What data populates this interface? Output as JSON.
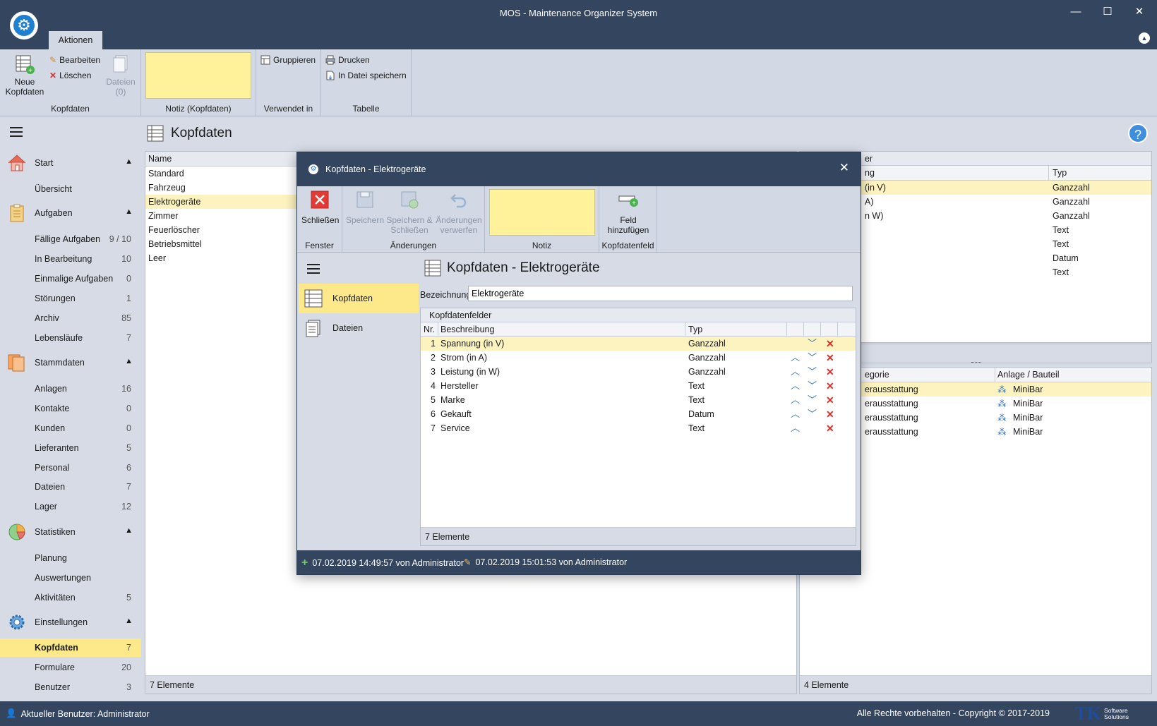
{
  "window": {
    "title": "MOS - Maintenance Organizer System",
    "minimize": "—",
    "maximize": "☐",
    "close": "✕"
  },
  "ribbon": {
    "tab_label": "Aktionen",
    "groups": {
      "kopfdaten": {
        "label": "Kopfdaten",
        "new_line1": "Neue",
        "new_line2": "Kopfdaten",
        "edit": "Bearbeiten",
        "delete": "Löschen",
        "files_line1": "Dateien",
        "files_line2": "(0)"
      },
      "notiz": {
        "label": "Notiz (Kopfdaten)"
      },
      "verwendet": {
        "label": "Verwendet in",
        "group": "Gruppieren"
      },
      "tabelle": {
        "label": "Tabelle",
        "print": "Drucken",
        "save_file": "In Datei speichern"
      }
    }
  },
  "sidebar": {
    "sections": [
      {
        "label": "Start",
        "icon": "house-icon"
      },
      {
        "label": "Aufgaben",
        "icon": "clipboard-icon"
      },
      {
        "label": "Stammdaten",
        "icon": "documents-icon"
      },
      {
        "label": "Statistiken",
        "icon": "pie-chart-icon"
      },
      {
        "label": "Einstellungen",
        "icon": "gear-icon"
      }
    ],
    "items": [
      {
        "label": "Übersicht",
        "count": ""
      },
      {
        "label": "Fällige Aufgaben",
        "count": "9 / 10"
      },
      {
        "label": "In Bearbeitung",
        "count": "10"
      },
      {
        "label": "Einmalige Aufgaben",
        "count": "0"
      },
      {
        "label": "Störungen",
        "count": "1"
      },
      {
        "label": "Archiv",
        "count": "85"
      },
      {
        "label": "Lebensläufe",
        "count": "7"
      },
      {
        "label": "Anlagen",
        "count": "16"
      },
      {
        "label": "Kontakte",
        "count": "0"
      },
      {
        "label": "Kunden",
        "count": "0"
      },
      {
        "label": "Lieferanten",
        "count": "5"
      },
      {
        "label": "Personal",
        "count": "6"
      },
      {
        "label": "Dateien",
        "count": "7"
      },
      {
        "label": "Lager",
        "count": "12"
      },
      {
        "label": "Planung",
        "count": ""
      },
      {
        "label": "Auswertungen",
        "count": ""
      },
      {
        "label": "Aktivitäten",
        "count": "5"
      },
      {
        "label": "Kopfdaten",
        "count": "7"
      },
      {
        "label": "Formulare",
        "count": "20"
      },
      {
        "label": "Benutzer",
        "count": "3"
      }
    ]
  },
  "page": {
    "title": "Kopfdaten",
    "help": "?"
  },
  "list": {
    "header": "Name",
    "rows": [
      "Standard",
      "Fahrzeug",
      "Elektrogeräte",
      "Zimmer",
      "Feuerlöscher",
      "Betriebsmittel",
      "Leer"
    ],
    "footer": "7 Elemente"
  },
  "right_top": {
    "group_header": "er",
    "col1": "ng",
    "col2": "Typ",
    "rows": [
      {
        "c1": "(in V)",
        "c2": "Ganzzahl"
      },
      {
        "c1": "A)",
        "c2": "Ganzzahl"
      },
      {
        "c1": "n W)",
        "c2": "Ganzzahl"
      },
      {
        "c1": "",
        "c2": "Text"
      },
      {
        "c1": "",
        "c2": "Text"
      },
      {
        "c1": "",
        "c2": "Datum"
      },
      {
        "c1": "",
        "c2": "Text"
      }
    ]
  },
  "right_bottom": {
    "col1": "egorie",
    "col2": "Anlage / Bauteil",
    "rows": [
      {
        "c1": "erausstattung",
        "c2": "MiniBar"
      },
      {
        "c1": "erausstattung",
        "c2": "MiniBar"
      },
      {
        "c1": "erausstattung",
        "c2": "MiniBar"
      },
      {
        "c1": "erausstattung",
        "c2": "MiniBar"
      }
    ],
    "footer": "4 Elemente"
  },
  "status": {
    "user": "Aktueller Benutzer: Administrator",
    "copyright": "Alle Rechte vorbehalten - Copyright © 2017-2019",
    "logo_tk": "TK",
    "logo_sub1": "Software",
    "logo_sub2": "Solutions"
  },
  "dialog": {
    "title": "Kopfdaten - Elektrogeräte",
    "ribbon": {
      "close": "Schließen",
      "group_fenster": "Fenster",
      "save": "Speichern",
      "save_close_line1": "Speichern &",
      "save_close_line2": "Schließen",
      "discard_line1": "Änderungen",
      "discard_line2": "verwerfen",
      "group_aenderungen": "Änderungen",
      "group_notiz": "Notiz",
      "add_field_line1": "Feld",
      "add_field_line2": "hinzufügen",
      "group_kopfdatenfeld": "Kopfdatenfeld"
    },
    "nav": [
      {
        "label": "Kopfdaten",
        "icon": "table-icon"
      },
      {
        "label": "Dateien",
        "icon": "document-icon"
      }
    ],
    "page_title": "Kopfdaten - Elektrogeräte",
    "bezeichnung_label": "Bezeichnung",
    "bezeichnung_value": "Elektrogeräte",
    "fields_title": "Kopfdatenfelder",
    "columns": {
      "nr": "Nr.",
      "desc": "Beschreibung",
      "type": "Typ"
    },
    "fields": [
      {
        "nr": "1",
        "desc": "Spannung (in V)",
        "type": "Ganzzahl"
      },
      {
        "nr": "2",
        "desc": "Strom (in A)",
        "type": "Ganzzahl"
      },
      {
        "nr": "3",
        "desc": "Leistung (in W)",
        "type": "Ganzzahl"
      },
      {
        "nr": "4",
        "desc": "Hersteller",
        "type": "Text"
      },
      {
        "nr": "5",
        "desc": "Marke",
        "type": "Text"
      },
      {
        "nr": "6",
        "desc": "Gekauft",
        "type": "Datum"
      },
      {
        "nr": "7",
        "desc": "Service",
        "type": "Text"
      }
    ],
    "fields_footer": "7 Elemente",
    "created": "07.02.2019 14:49:57 von Administrator",
    "modified": "07.02.2019 15:01:53 von Administrator"
  },
  "colors": {
    "title_bar": "#34455f",
    "ribbon": "#d2d8e4",
    "selection": "#fde98a",
    "note": "#fff29b",
    "accent": "#1f7fd0",
    "delete": "#d9302b"
  }
}
